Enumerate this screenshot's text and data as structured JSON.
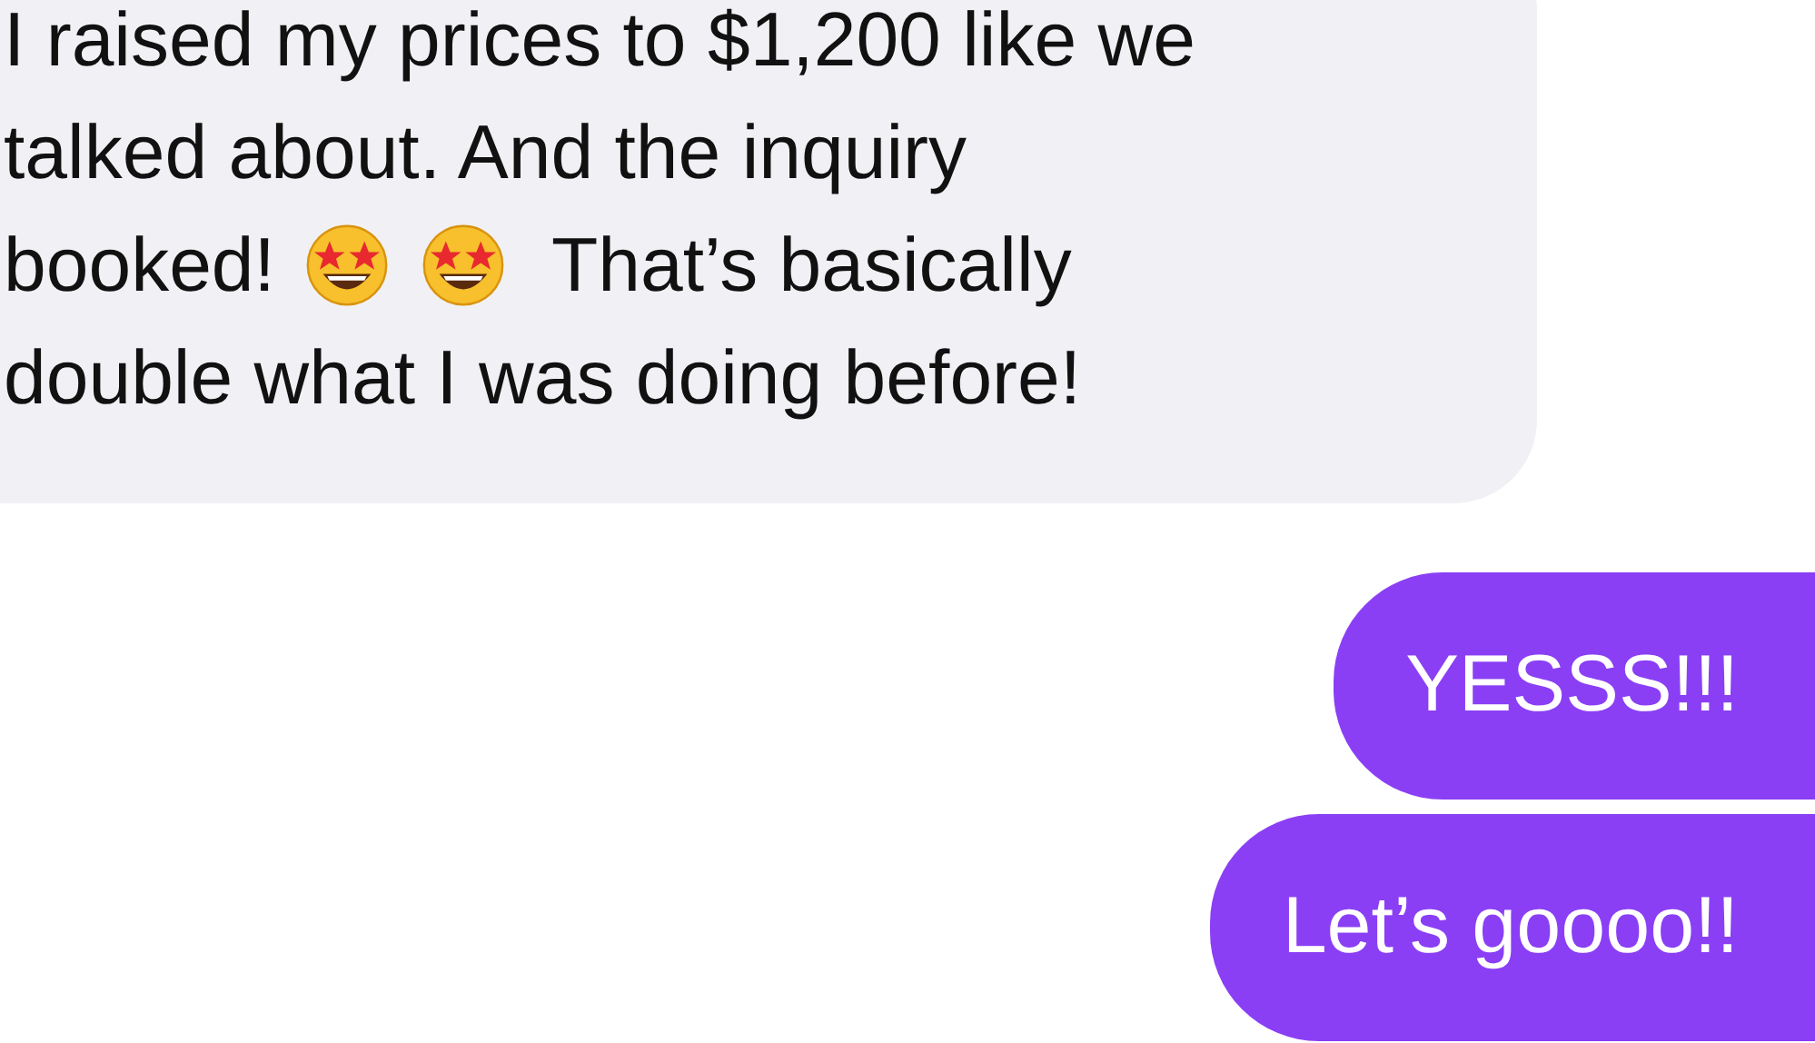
{
  "messages": [
    {
      "kind": "incoming",
      "lines": [
        [
          {
            "kind": "text",
            "text": "I raised my prices to $1,200 like we"
          }
        ],
        [
          {
            "kind": "text",
            "text": "talked about. And the inquiry"
          }
        ],
        [
          {
            "kind": "text",
            "text": "booked!"
          },
          {
            "kind": "star-struck"
          },
          {
            "kind": "star-struck"
          },
          {
            "kind": "text",
            "text": "That’s basically"
          }
        ],
        [
          {
            "kind": "text",
            "text": "double what I was doing before!"
          }
        ]
      ]
    },
    {
      "kind": "outgoing",
      "lines": [
        [
          {
            "kind": "text",
            "text": "YESSS!!!"
          }
        ]
      ]
    },
    {
      "kind": "outgoing",
      "lines": [
        [
          {
            "kind": "text",
            "text": "Let’s goooo!!"
          }
        ]
      ]
    }
  ]
}
